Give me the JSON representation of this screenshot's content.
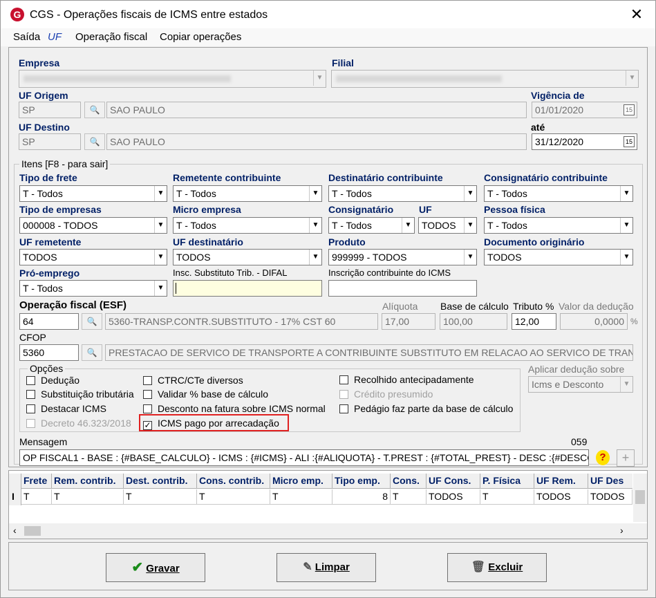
{
  "window": {
    "title": "CGS - Operações fiscais de ICMS entre estados",
    "close": "✕",
    "logo": "G"
  },
  "menu": [
    "Saída",
    "UF",
    "Operação fiscal",
    "Copiar operações"
  ],
  "colors": {
    "label_blue": "#001f66",
    "highlight_red": "#e02020",
    "field_yellow": "#fefee0"
  },
  "header": {
    "empresa_label": "Empresa",
    "filial_label": "Filial",
    "uf_origem_label": "UF Origem",
    "uf_origem_code": "SP",
    "uf_origem_name": "SAO PAULO",
    "uf_destino_label": "UF Destino",
    "uf_destino_code": "SP",
    "uf_destino_name": "SAO PAULO",
    "vigencia_label": "Vigência de",
    "vigencia_de": "01/01/2020",
    "ate_label": "até",
    "vigencia_ate": "31/12/2020"
  },
  "itens": {
    "group_label": "Itens [F8 - para sair]",
    "tipo_frete_label": "Tipo de frete",
    "tipo_frete": "T - Todos",
    "remetente_label": "Remetente contribuinte",
    "remetente": "T - Todos",
    "destinatario_label": "Destinatário contribuinte",
    "destinatario": "T - Todos",
    "consignatario_contrib_label": "Consignatário contribuinte",
    "consignatario_contrib": "T - Todos",
    "tipo_empresas_label": "Tipo de empresas",
    "tipo_empresas": "000008 - TODOS",
    "micro_label": "Micro empresa",
    "micro": "T - Todos",
    "consignatario_label": "Consignatário",
    "consignatario": "T - Todos",
    "uf_label": "UF",
    "uf": "TODOS",
    "pessoa_label": "Pessoa física",
    "pessoa": "T - Todos",
    "uf_rem_label": "UF remetente",
    "uf_rem": "TODOS",
    "uf_dest_label": "UF destinatário",
    "uf_dest": "TODOS",
    "produto_label": "Produto",
    "produto": "999999 - TODOS",
    "doc_label": "Documento originário",
    "doc": "TODOS",
    "pro_emprego_label": "Pró-emprego",
    "pro_emprego": "T - Todos",
    "insc_subst_label": "Insc. Substituto Trib. - DIFAL",
    "insc_subst": "",
    "insc_contrib_label": "Inscrição contribuinte do ICMS",
    "insc_contrib": ""
  },
  "operacao": {
    "label": "Operação fiscal (ESF)",
    "code": "64",
    "desc": "5360-TRANSP.CONTR.SUBSTITUTO - 17% CST 60",
    "aliquota_label": "Alíquota",
    "aliquota": "17,00",
    "base_label": "Base de cálculo",
    "base": "100,00",
    "tributo_label": "Tributo %",
    "tributo": "12,00",
    "deducao_label": "Valor da dedução",
    "deducao": "0,0000",
    "pct": "%",
    "cfop_label": "CFOP",
    "cfop": "5360",
    "cfop_desc": "PRESTACAO DE SERVICO DE TRANSPORTE A CONTRIBUINTE SUBSTITUTO EM RELACAO AO SERVICO DE TRANS"
  },
  "opcoes": {
    "label": "Opções",
    "items": [
      {
        "label": "Dedução",
        "checked": false,
        "disabled": false
      },
      {
        "label": "Substituição tributária",
        "checked": false,
        "disabled": false
      },
      {
        "label": "Destacar ICMS",
        "checked": false,
        "disabled": false
      },
      {
        "label": "Decreto 46.323/2018",
        "checked": false,
        "disabled": true
      },
      {
        "label": "CTRC/CTe diversos",
        "checked": false,
        "disabled": false
      },
      {
        "label": "Validar % base de cálculo",
        "checked": false,
        "disabled": false
      },
      {
        "label": "Desconto na fatura sobre ICMS normal",
        "checked": false,
        "disabled": false
      },
      {
        "label": "ICMS pago por arrecadação",
        "checked": true,
        "disabled": false
      },
      {
        "label": "Recolhido antecipadamente",
        "checked": false,
        "disabled": false
      },
      {
        "label": "Crédito presumido",
        "checked": false,
        "disabled": true
      },
      {
        "label": "Pedágio faz parte da base de cálculo",
        "checked": false,
        "disabled": false
      }
    ],
    "check_mark": "✓",
    "aplicar_label": "Aplicar dedução sobre",
    "aplicar": "Icms e Desconto"
  },
  "mensagem": {
    "label": "Mensagem",
    "count": "059",
    "text": "OP FISCAL1 - BASE : {#BASE_CALCULO} - ICMS : {#ICMS} - ALI :{#ALIQUOTA} - T.PREST : {#TOTAL_PREST} - DESC :{#DESCO",
    "help": "?",
    "add": "+"
  },
  "grid": {
    "headers": [
      "Frete",
      "Rem. contrib.",
      "Dest. contrib.",
      "Cons. contrib.",
      "Micro emp.",
      "Tipo emp.",
      "Cons.",
      "UF Cons.",
      "P. Física",
      "UF Rem.",
      "UF Des"
    ],
    "row": [
      "T",
      "T",
      "T",
      "T",
      "T",
      "8",
      "T",
      "TODOS",
      "T",
      "TODOS",
      "TODOS"
    ],
    "row_marker": "I"
  },
  "buttons": {
    "gravar": "Gravar",
    "limpar": "Limpar",
    "excluir": "Excluir"
  }
}
